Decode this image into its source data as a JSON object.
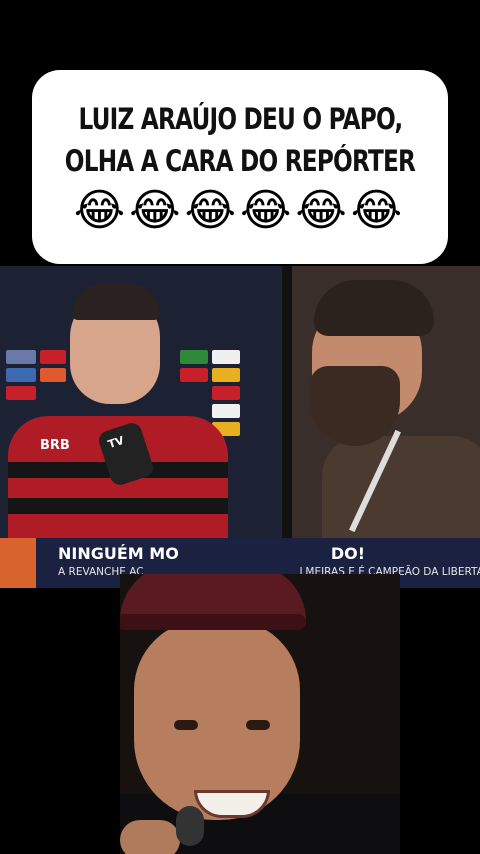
{
  "caption": {
    "line1": "LUIZ ARAÚJO DEU O PAPO,",
    "line2": "OLHA A CARA DO REPÓRTER",
    "emojis": "😂😂😂😂😂😂"
  },
  "broadcast": {
    "headline": "NINGUÉM MO",
    "headline_end": "DO!",
    "subline_left": "A REVANCHE AC",
    "subline_right": "LMEIRAS E É CAMPEÃO DA LIBERTADORES",
    "sponsor_jersey": "BRB",
    "sponsor_jersey_2": "BRB",
    "mic_brand": "TV"
  },
  "colors": {
    "card_bg": "#ffffff",
    "caption_text": "#111111",
    "lower_third_bg": "#1b2140",
    "accent": "#d8632c",
    "jersey_red": "#b01c25"
  }
}
